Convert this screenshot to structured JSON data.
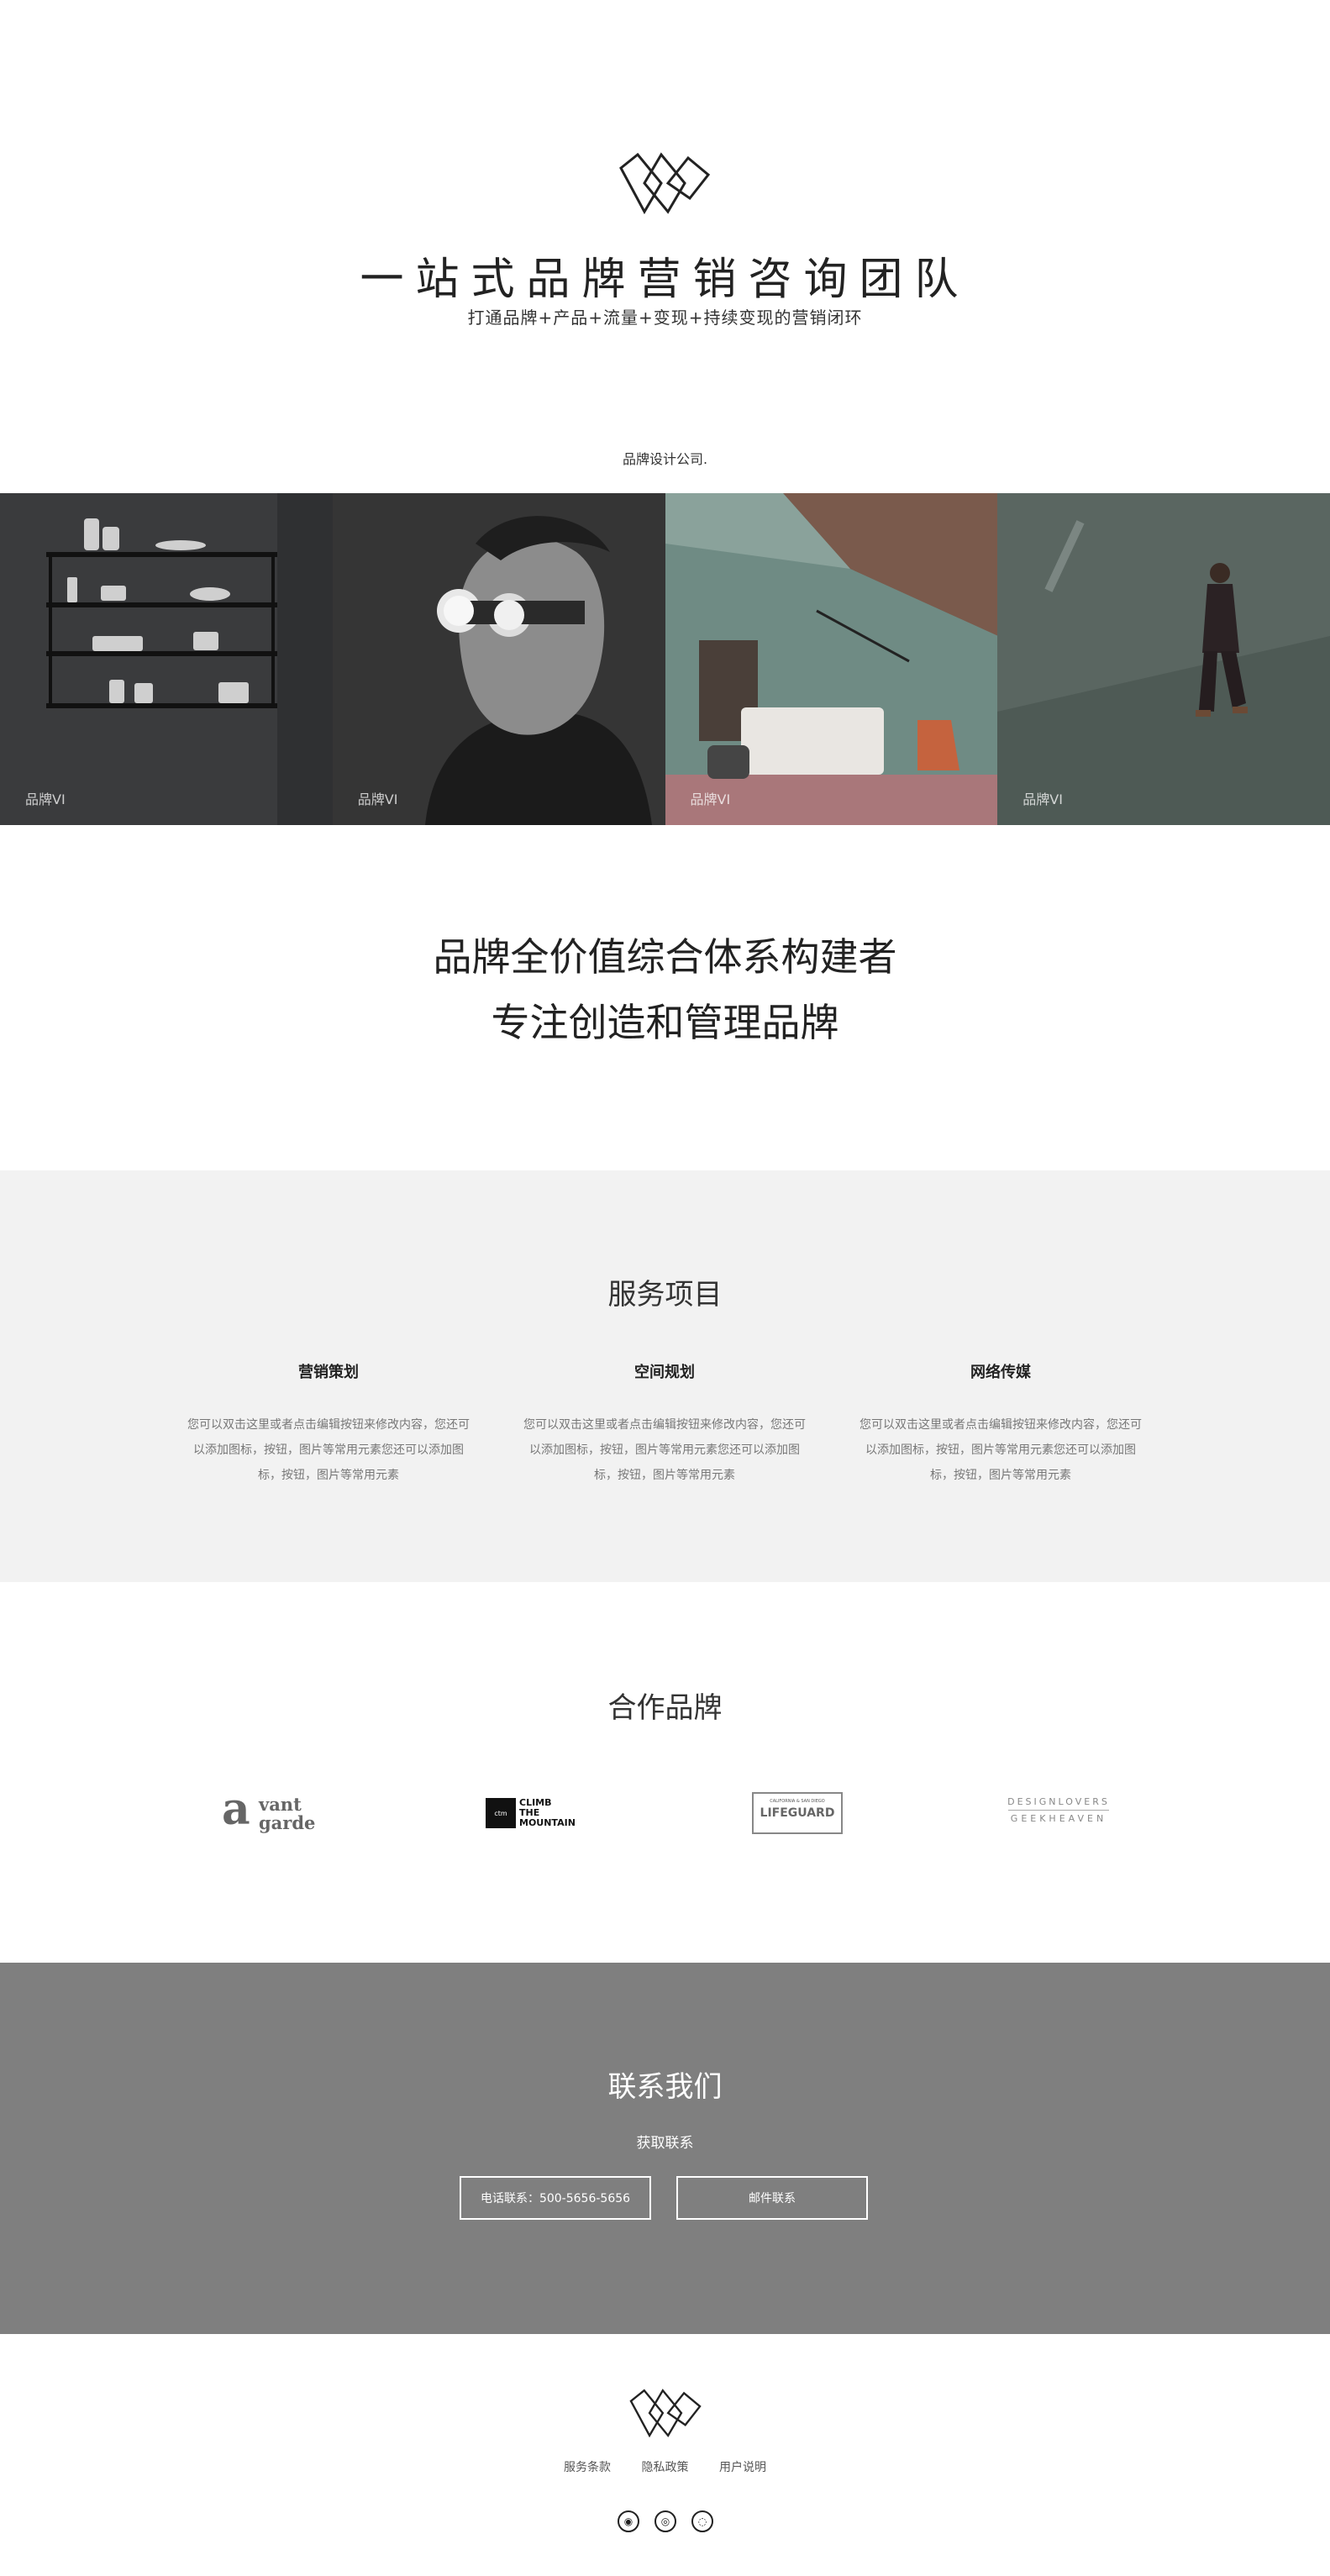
{
  "hero": {
    "title": "一站式品牌营销咨询团队",
    "subtitle": "打通品牌+产品+流量+变现+持续变现的营销闭环",
    "caption": "品牌设计公司."
  },
  "gallery": [
    {
      "label": "品牌VI"
    },
    {
      "label": "品牌VI"
    },
    {
      "label": "品牌VI"
    },
    {
      "label": "品牌VI"
    }
  ],
  "tagline": {
    "line1": "品牌全价值综合体系构建者",
    "line2": "专注创造和管理品牌"
  },
  "services": {
    "title": "服务项目",
    "items": [
      {
        "name": "营销策划",
        "desc": "您可以双击这里或者点击编辑按钮来修改内容，您还可以添加图标，按钮，图片等常用元素您还可以添加图标，按钮，图片等常用元素"
      },
      {
        "name": "空间规划",
        "desc": "您可以双击这里或者点击编辑按钮来修改内容，您还可以添加图标，按钮，图片等常用元素您还可以添加图标，按钮，图片等常用元素"
      },
      {
        "name": "网络传媒",
        "desc": "您可以双击这里或者点击编辑按钮来修改内容，您还可以添加图标，按钮，图片等常用元素您还可以添加图标，按钮，图片等常用元素"
      }
    ]
  },
  "partners": {
    "title": "合作品牌",
    "brands": {
      "avantgarde": {
        "letter": "a",
        "line1": "vant",
        "line2": "garde"
      },
      "climb": {
        "badge": "ctm",
        "line1": "CLIMB",
        "line2": "THE",
        "line3": "MOUNTAIN"
      },
      "lifeguard": {
        "top": "CALIFORNIA & SAN DIEGO",
        "name": "LIFEGUARD"
      },
      "designlovers": {
        "line1": "DESIGNLOVERS",
        "line2": "GEEKHEAVEN"
      }
    }
  },
  "contact": {
    "title": "联系我们",
    "subtitle": "获取联系",
    "phone_button": "电话联系：500-5656-5656",
    "email_button": "邮件联系"
  },
  "footer": {
    "links": [
      "服务条款",
      "隐私政策",
      "用户说明"
    ],
    "social": [
      {
        "icon": "qq-icon",
        "glyph": "◉"
      },
      {
        "icon": "weibo-icon",
        "glyph": "◎"
      },
      {
        "icon": "wechat-icon",
        "glyph": "◌"
      }
    ]
  },
  "colors": {
    "services_bg": "#f2f2f2",
    "contact_bg": "#7f7f7f",
    "text": "#222222"
  }
}
